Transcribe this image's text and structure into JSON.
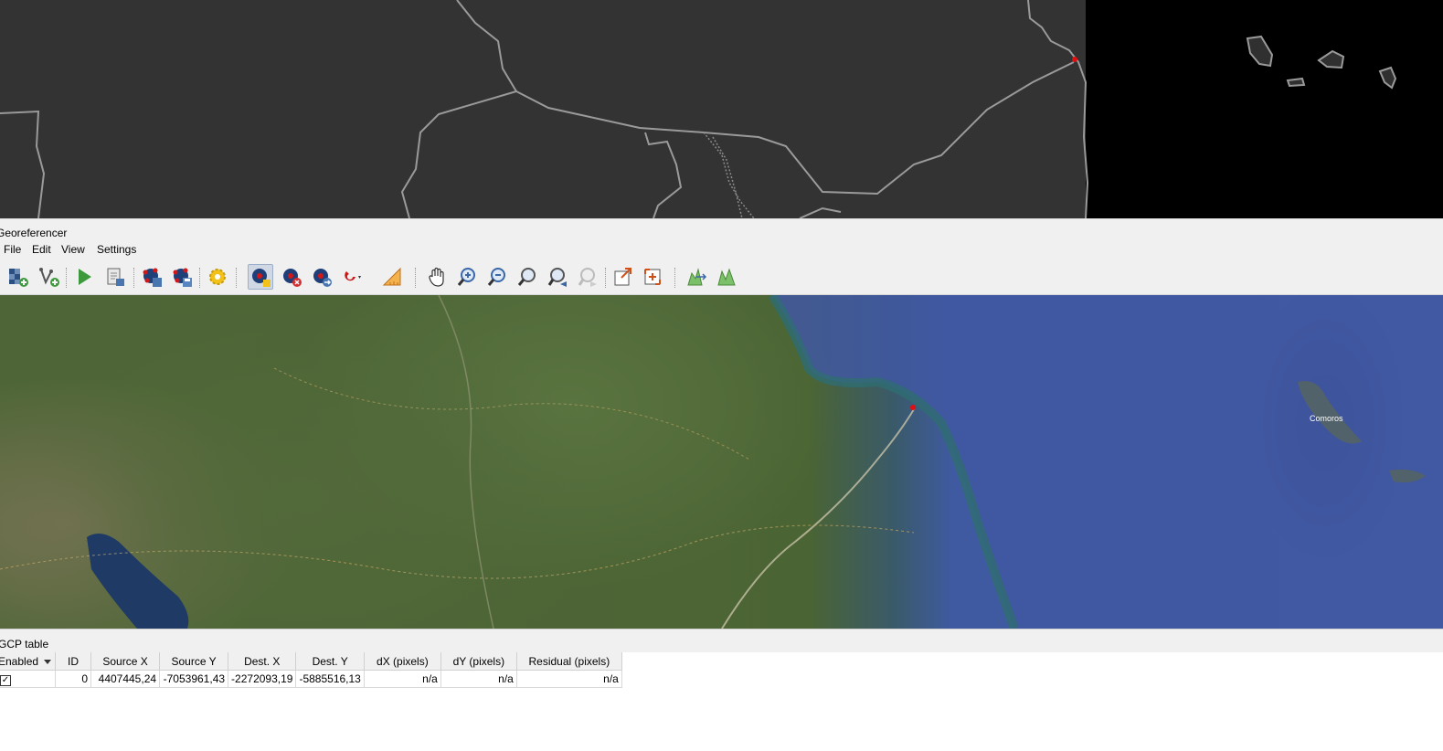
{
  "window": {
    "title": "Georeferencer"
  },
  "menu": {
    "items": [
      "File",
      "Edit",
      "View",
      "Settings"
    ]
  },
  "toolbar": {
    "tools": [
      "open-raster-icon",
      "start-georeferencing-icon",
      "generate-gdal-script-icon",
      "load-gcp-points-icon",
      "save-gcp-points-icon",
      "transformation-settings-icon",
      "add-point-icon",
      "delete-point-icon",
      "move-gcp-icon",
      "snap-icon",
      "pan-icon",
      "zoom-in-icon",
      "zoom-out-icon",
      "zoom-to-layer-icon",
      "zoom-last-icon",
      "zoom-next-icon",
      "link-georeferencer-to-qgis-icon",
      "link-qgis-to-georeferencer-icon",
      "local-histogram-stretch-icon",
      "full-histogram-stretch-icon"
    ]
  },
  "map": {
    "label": "Comoros",
    "ocean_color": "#4359a3",
    "land_color": "#4e6637"
  },
  "gcp": {
    "title": "GCP table",
    "columns": [
      "Enabled",
      "ID",
      "Source X",
      "Source Y",
      "Dest. X",
      "Dest. Y",
      "dX (pixels)",
      "dY (pixels)",
      "Residual (pixels)"
    ],
    "rows": [
      {
        "enabled": "✓",
        "id": "0",
        "source_x": "4407445,24",
        "source_y": "-7053961,43",
        "dest_x": "-2272093,19",
        "dest_y": "-5885516,13",
        "dx": "n/a",
        "dy": "n/a",
        "residual": "n/a"
      }
    ]
  }
}
